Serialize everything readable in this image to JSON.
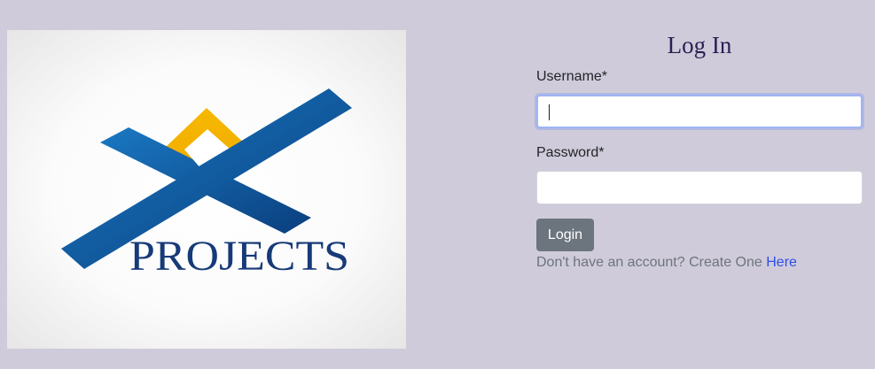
{
  "logo": {
    "wordmark": "PROJECTS",
    "colors": {
      "blue": "#0a5ea8",
      "blue_dark": "#0a3f7e",
      "gold": "#f6b800",
      "text": "#173a78"
    }
  },
  "login": {
    "title": "Log In",
    "username_label": "Username*",
    "username_value": "",
    "password_label": "Password*",
    "password_value": "",
    "login_button": "Login",
    "signup_text": "Don't have an account? Create One",
    "signup_link": "Here"
  },
  "colors": {
    "page_background": "#d0cbda",
    "title_color": "#2b1f55",
    "button_background": "#6c757d",
    "link_color": "#2f4ee6"
  }
}
